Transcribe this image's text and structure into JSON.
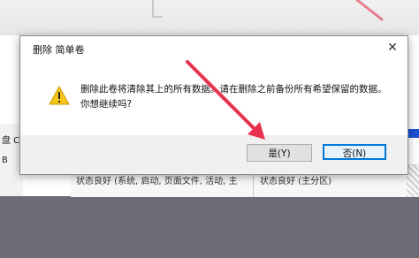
{
  "background": {
    "table_cells": [
      "状态良好 (系统, 启动, 页面文件, 活动, 主",
      "状态良好 (主分区)"
    ],
    "left_panel_letters": [
      "盘 C",
      "B"
    ]
  },
  "dialog": {
    "title": "删除 简单卷",
    "close_glyph": "✕",
    "icon": "warning-icon",
    "message": "删除此卷将清除其上的所有数据。请在删除之前备份所有希望保留的数据。你想继续吗?",
    "buttons": {
      "yes": "是(Y)",
      "no": "否(N)"
    }
  },
  "colors": {
    "annotation_arrow": "#e8314f",
    "warning_yellow": "#f7c619",
    "focus_blue": "#0078d7",
    "highlight_strip": "#1c4fd6"
  }
}
